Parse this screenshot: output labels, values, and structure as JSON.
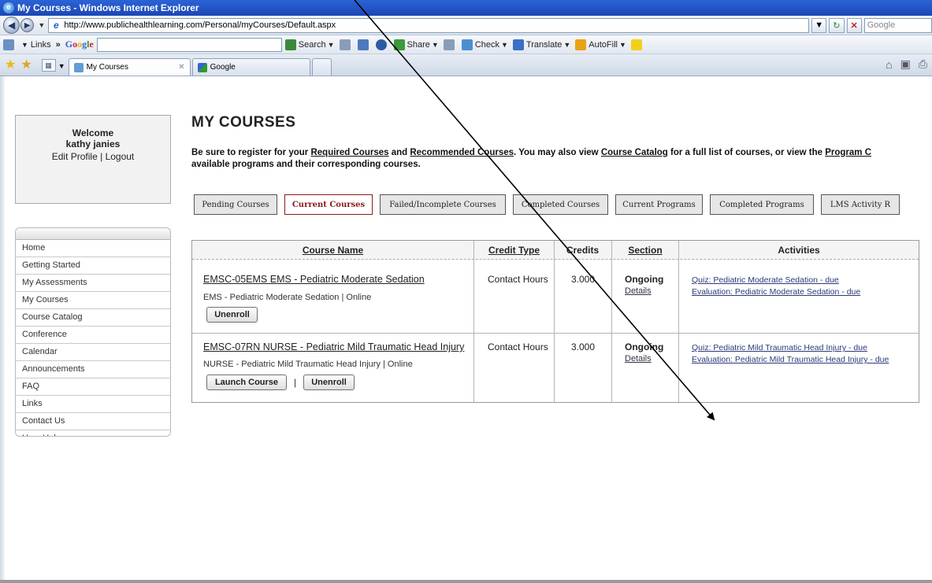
{
  "window": {
    "title": "My Courses - Windows Internet Explorer"
  },
  "address_bar": {
    "url": "http://www.publichealthlearning.com/Personal/myCourses/Default.aspx",
    "search_placeholder": "Google"
  },
  "toolbar": {
    "links_label": "Links",
    "search_label": "Search",
    "share_label": "Share",
    "check_label": "Check",
    "translate_label": "Translate",
    "autofill_label": "AutoFill"
  },
  "browser_tabs": [
    {
      "label": "My Courses",
      "active": true
    },
    {
      "label": "Google",
      "active": false
    }
  ],
  "welcome": {
    "title": "Welcome",
    "name": "kathy janies",
    "edit_profile": "Edit Profile",
    "separator": "|",
    "logout": "Logout"
  },
  "sidebar": {
    "items": [
      "Home",
      "Getting Started",
      "My Assessments",
      "My Courses",
      "Course Catalog",
      "Conference",
      "Calendar",
      "Announcements",
      "FAQ",
      "Links",
      "Contact Us",
      "User Help"
    ]
  },
  "page": {
    "title": "MY COURSES",
    "intro_1": "Be sure to register for your ",
    "intro_link_required": "Required Courses",
    "intro_2": " and ",
    "intro_link_recommended": "Recommended Courses",
    "intro_3": ". You may also view ",
    "intro_link_catalog": "Course Catalog",
    "intro_4": " for a full list of courses, or view the ",
    "intro_link_program": "Program C",
    "intro_line2": "available programs and their corresponding courses."
  },
  "course_tabs": [
    {
      "label": "Pending Courses",
      "active": false
    },
    {
      "label": "Current Courses",
      "active": true
    },
    {
      "label": "Failed/Incomplete Courses",
      "active": false
    },
    {
      "label": "Completed Courses",
      "active": false
    },
    {
      "label": "Current Programs",
      "active": false
    },
    {
      "label": "Completed Programs",
      "active": false
    },
    {
      "label": "LMS Activity R",
      "active": false
    }
  ],
  "table": {
    "headers": {
      "course_name": "Course Name",
      "credit_type": "Credit Type",
      "credits": "Credits",
      "section": "Section",
      "activities": "Activities"
    },
    "rows": [
      {
        "course_name": "EMSC-05EMS EMS - Pediatric Moderate Sedation",
        "description": "EMS - Pediatric Moderate Sedation |  Online",
        "credit_type": "Contact Hours",
        "credits": "3.000",
        "section_status": "Ongoing",
        "section_link": "Details",
        "activities": [
          "Quiz: Pediatric Moderate Sedation - due",
          "Evaluation: Pediatric Moderate Sedation - due"
        ],
        "unenroll": "Unenroll"
      },
      {
        "course_name": "EMSC-07RN NURSE - Pediatric Mild Traumatic Head Injury",
        "description": "NURSE - Pediatric Mild Traumatic Head Injury |  Online",
        "credit_type": "Contact Hours",
        "credits": "3.000",
        "section_status": "Ongoing",
        "section_link": "Details",
        "activities": [
          "Quiz: Pediatric Mild Traumatic Head Injury - due",
          "Evaluation: Pediatric Mild Traumatic Head Injury - due"
        ],
        "launch": "Launch Course",
        "separator": "|",
        "unenroll": "Unenroll"
      }
    ]
  },
  "colors": {
    "active_tab_text": "#8b1a1a",
    "titlebar": "#1b47b5",
    "activity_link": "#2a3a78"
  }
}
